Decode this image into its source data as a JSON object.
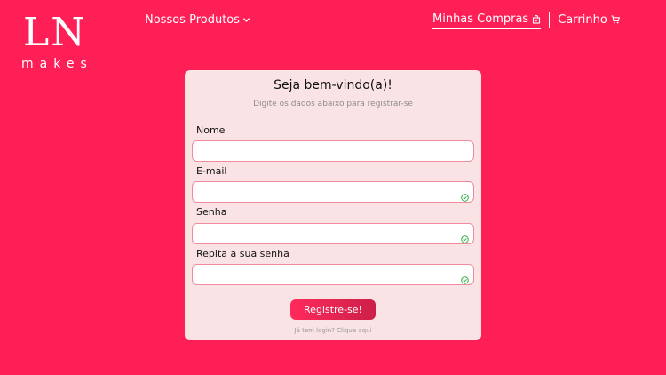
{
  "logo": {
    "mark": "LN",
    "sub": "makes"
  },
  "nav": {
    "products_label": "Nossos Produtos",
    "purchases_label": "Minhas Compras",
    "cart_label": "Carrinho"
  },
  "form": {
    "title": "Seja bem-vindo(a)!",
    "subtitle": "Digite os dados abaixo para registrar-se",
    "fields": [
      {
        "label": "Nome",
        "value": "",
        "valid": false
      },
      {
        "label": "E-mail",
        "value": "",
        "valid": true
      },
      {
        "label": "Senha",
        "value": "",
        "valid": true
      },
      {
        "label": "Repita a sua senha",
        "value": "",
        "valid": true
      }
    ],
    "submit_label": "Registre-se!",
    "login_hint": "Já tem login? Clique aqui"
  },
  "colors": {
    "background": "#ff1f57",
    "card": "#fae3e4",
    "field_border": "#f08a9c",
    "check": "#22a83a"
  },
  "icons": [
    "chevron-down-icon",
    "shopping-bag-icon",
    "cart-icon",
    "check-icon"
  ]
}
